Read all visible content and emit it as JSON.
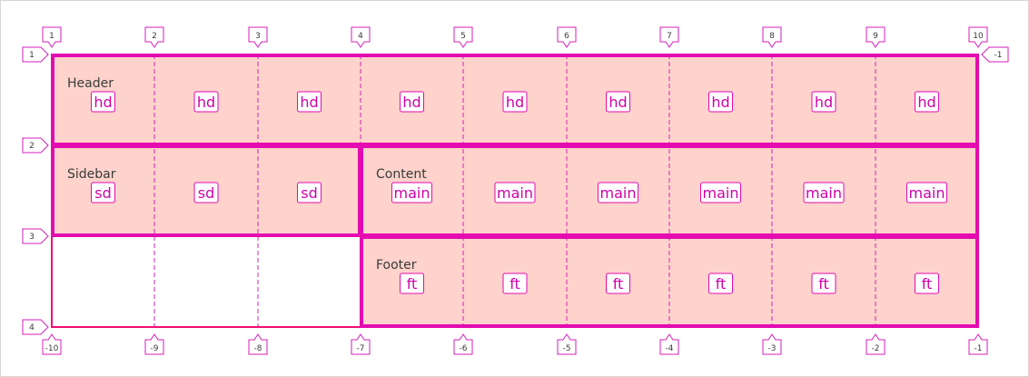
{
  "grid": {
    "columns": 9,
    "rows": 3,
    "top_line_numbers": [
      "1",
      "2",
      "3",
      "4",
      "5",
      "6",
      "7",
      "8",
      "9",
      "10"
    ],
    "bottom_line_numbers": [
      "-10",
      "-9",
      "-8",
      "-7",
      "-6",
      "-5",
      "-4",
      "-3",
      "-2",
      "-1"
    ],
    "left_row_numbers": [
      "1",
      "2",
      "3",
      "4"
    ],
    "right_row_numbers": [
      "-1"
    ]
  },
  "areas": [
    {
      "id": "header",
      "title": "Header",
      "name": "hd",
      "row": 1,
      "col_start": 1,
      "col_end": 9
    },
    {
      "id": "sidebar",
      "title": "Sidebar",
      "name": "sd",
      "row": 2,
      "col_start": 1,
      "col_end": 3
    },
    {
      "id": "content",
      "title": "Content",
      "name": "main",
      "row": 2,
      "col_start": 4,
      "col_end": 9
    },
    {
      "id": "footer",
      "title": "Footer",
      "name": "ft",
      "row": 3,
      "col_start": 4,
      "col_end": 9
    }
  ],
  "colors": {
    "area_fill": "#fdd3cb",
    "area_border": "#e40bb0",
    "grid_line": "#d51fbb",
    "track_outline": "#f0106f",
    "badge_text": "#d000a8"
  }
}
